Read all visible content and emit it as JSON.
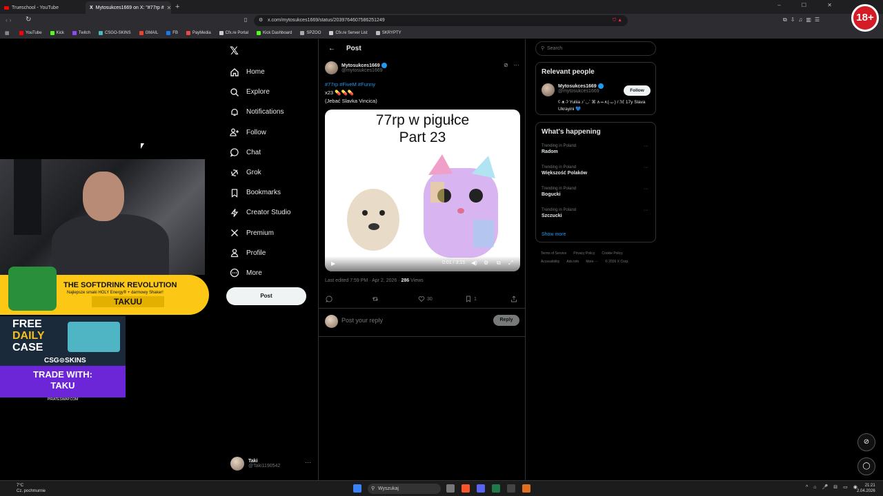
{
  "browser": {
    "tabs": [
      {
        "title": "Trueschool - YouTube",
        "active": false
      },
      {
        "title": "Mytosukces1669 on X: \"#77rp #",
        "active": true
      }
    ],
    "url": "x.com/mytosukces1669/status/2039764607586251249",
    "bookmarks": [
      {
        "label": "YouTube",
        "color": "#ff0000"
      },
      {
        "label": "Kick",
        "color": "#53fc18"
      },
      {
        "label": "Twitch",
        "color": "#9146ff"
      },
      {
        "label": "CSGO-SKINS",
        "color": "#4fb4c4"
      },
      {
        "label": "GMAIL",
        "color": "#ea4335"
      },
      {
        "label": "FB",
        "color": "#1877f2"
      },
      {
        "label": "PayMedia",
        "color": "#e84a4a"
      },
      {
        "label": "Cfx.re Portal",
        "color": "#cccccc"
      },
      {
        "label": "Kick Dashboard",
        "color": "#53fc18"
      },
      {
        "label": "SPZOO",
        "color": "#aaaaaa"
      },
      {
        "label": "Cfx.re Server List",
        "color": "#cccccc"
      },
      {
        "label": "SKRYPTY",
        "color": "#bbbbbb"
      }
    ],
    "age_badge": "18+"
  },
  "nav": {
    "logo": "𝕏",
    "items": [
      {
        "label": "Home",
        "icon": "home-icon"
      },
      {
        "label": "Explore",
        "icon": "search-icon"
      },
      {
        "label": "Notifications",
        "icon": "bell-icon"
      },
      {
        "label": "Follow",
        "icon": "follow-icon"
      },
      {
        "label": "Chat",
        "icon": "chat-icon"
      },
      {
        "label": "Grok",
        "icon": "grok-icon"
      },
      {
        "label": "Bookmarks",
        "icon": "bookmark-icon"
      },
      {
        "label": "Creator Studio",
        "icon": "lightning-icon"
      },
      {
        "label": "Premium",
        "icon": "x-icon"
      },
      {
        "label": "Profile",
        "icon": "person-icon"
      },
      {
        "label": "More",
        "icon": "more-icon"
      }
    ],
    "post_button": "Post",
    "user": {
      "name": "Taki",
      "handle": "@Taki1190542"
    }
  },
  "post": {
    "header": "Post",
    "author": {
      "name": "Mytosukces1669",
      "handle": "@mytosukces1669"
    },
    "tags": "#77rp #FiveM #Funny",
    "line2": "x23 💊💊💊",
    "line3": "(Jebać Slavka Vincica)",
    "media_title1": "77rp w pigułce",
    "media_title2": "Part 23",
    "video_time": "0:01 / 3:15",
    "edited": "Last edited 7:59 PM · Apr 2, 2026 · ",
    "views_count": "286",
    "views_label": " Views",
    "retweets": "",
    "likes": "30",
    "bookmarks": "1",
    "reply_placeholder": "Post your reply",
    "reply_button": "Reply"
  },
  "sidebar": {
    "search_placeholder": "Search",
    "relevant_title": "Relevant people",
    "relevant": {
      "name": "Mytosukces1669",
      "handle": "@mytosukces1669",
      "bio": "ʕ·ᴥ·ʔ Yuliia ♪´◡` ꕤ ∧ꕀ∧(·ᴗ·) / ℳ 17y Slava Ukrayini 💙",
      "follow": "Follow"
    },
    "happening_title": "What's happening",
    "trends": [
      {
        "context": "Trending in Poland",
        "name": "Radom"
      },
      {
        "context": "Trending in Poland",
        "name": "Większość Polaków"
      },
      {
        "context": "Trending in Poland",
        "name": "Bogucki"
      },
      {
        "context": "Trending in Poland",
        "name": "Szczucki"
      }
    ],
    "show_more": "Show more",
    "footer": [
      "Terms of Service",
      "Privacy Policy",
      "Cookie Policy",
      "Accessibility",
      "Ads info",
      "More ···",
      "© 2026 X Corp."
    ]
  },
  "overlay": {
    "softdrink_headline": "THE SOFTDRINK REVOLUTION",
    "softdrink_sub": "Najlepsze smaki HOLY Energy® + darmowy Shaker!",
    "softdrink_code": "TAKUU",
    "free_daily": [
      "FREE",
      "DAILY",
      "CASE"
    ],
    "csg_brand": "CSG⊙SKINS",
    "trade_line1": "TRADE WITH:",
    "trade_line2": "TAKU",
    "pirate": "PIRATESWAP.COM"
  },
  "taskbar": {
    "weather_temp": "7°C",
    "weather_desc": "Cz. pochmurnie",
    "search": "Wyszukaj",
    "time": "21:21",
    "date": "2.04.2026"
  },
  "colors": {
    "accent": "#1d9bf0",
    "border": "#2f3336",
    "muted": "#71767b"
  }
}
